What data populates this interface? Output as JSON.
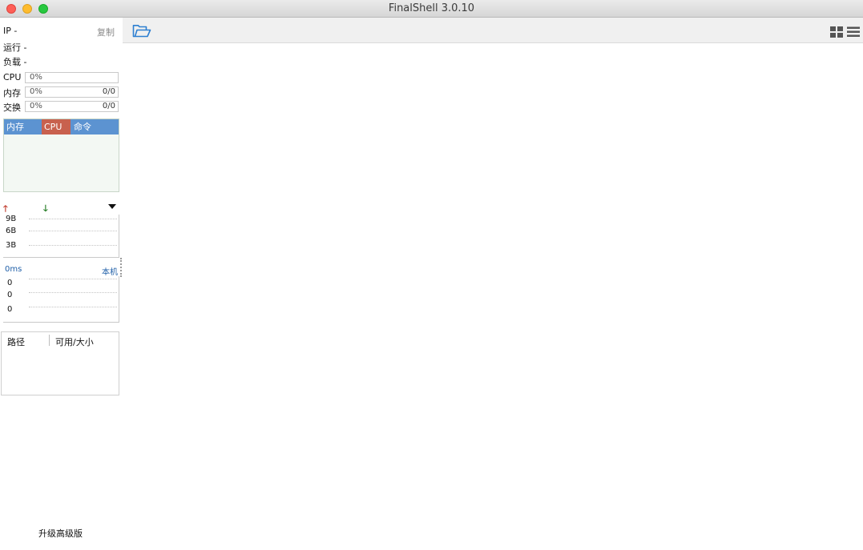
{
  "window": {
    "title": "FinalShell 3.0.10"
  },
  "sidebar": {
    "ip_label": "IP  -",
    "copy_label": "复制",
    "uptime_label": "运行 -",
    "load_label": "负载 -",
    "meters": {
      "cpu": {
        "label": "CPU",
        "percent": "0%",
        "fraction": 0
      },
      "memory": {
        "label": "内存",
        "percent": "0%",
        "ratio": "0/0",
        "fraction": 0
      },
      "swap": {
        "label": "交换",
        "percent": "0%",
        "ratio": "0/0",
        "fraction": 0
      }
    },
    "process_tabs": {
      "memory": "内存",
      "cpu": "CPU",
      "command": "命令"
    },
    "network": {
      "up_symbol": "🡑",
      "down_symbol": "🡓",
      "ticks": [
        "9B",
        "6B",
        "3B"
      ]
    },
    "ping": {
      "latency": "0ms",
      "host": "本机",
      "ticks": [
        "0",
        "0",
        "0"
      ]
    },
    "disk": {
      "path_header": "路径",
      "size_header": "可用/大小"
    },
    "upgrade_label": "升级高级版"
  },
  "icons": {
    "folder": "folder-open-icon",
    "grid_view": "grid-view-icon",
    "list_view": "list-view-icon"
  },
  "colors": {
    "process_header": "#5c93d1",
    "cpu_tab": "#c8614e",
    "upload_arrow": "#c0392b",
    "download_arrow": "#1f7a1f",
    "link_blue": "#1f5fa8"
  }
}
